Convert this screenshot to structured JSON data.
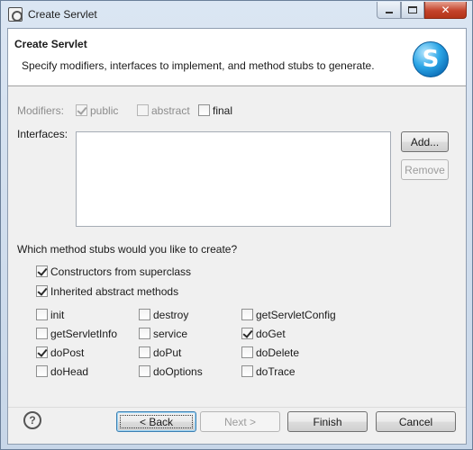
{
  "window": {
    "title": "Create Servlet",
    "close_glyph": "✕",
    "icons": {
      "app": "servlet-wizard-icon",
      "minimize": "minimize-icon",
      "maximize": "maximize-icon",
      "close": "close-icon"
    }
  },
  "banner": {
    "title": "Create Servlet",
    "description": "Specify modifiers, interfaces to implement, and method stubs to generate.",
    "logo_letter": "S"
  },
  "modifiers": {
    "label": "Modifiers:",
    "options": [
      {
        "label": "public",
        "checked": true,
        "enabled": false
      },
      {
        "label": "abstract",
        "checked": false,
        "enabled": false
      },
      {
        "label": "final",
        "checked": false,
        "enabled": true
      }
    ]
  },
  "interfaces": {
    "label": "Interfaces:",
    "items": [],
    "add_label": "Add...",
    "remove_label": "Remove"
  },
  "stubs": {
    "question": "Which method stubs would you like to create?",
    "general": [
      {
        "label": "Constructors from superclass",
        "checked": true
      },
      {
        "label": "Inherited abstract methods",
        "checked": true
      }
    ],
    "methods": [
      {
        "label": "init",
        "checked": false
      },
      {
        "label": "destroy",
        "checked": false
      },
      {
        "label": "getServletConfig",
        "checked": false
      },
      {
        "label": "getServletInfo",
        "checked": false
      },
      {
        "label": "service",
        "checked": false
      },
      {
        "label": "doGet",
        "checked": true
      },
      {
        "label": "doPost",
        "checked": true
      },
      {
        "label": "doPut",
        "checked": false
      },
      {
        "label": "doDelete",
        "checked": false
      },
      {
        "label": "doHead",
        "checked": false
      },
      {
        "label": "doOptions",
        "checked": false
      },
      {
        "label": "doTrace",
        "checked": false
      }
    ]
  },
  "footer": {
    "help_glyph": "?",
    "back_label": "< Back",
    "next_label": "Next >",
    "finish_label": "Finish",
    "cancel_label": "Cancel"
  }
}
